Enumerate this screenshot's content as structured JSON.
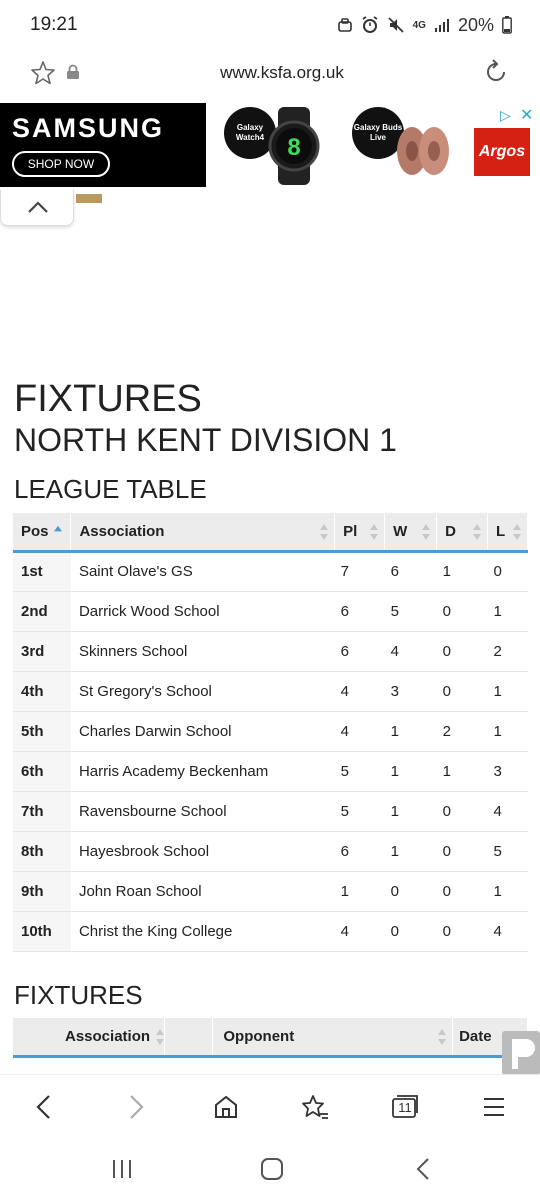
{
  "status": {
    "time": "19:21",
    "network": "4G",
    "battery": "20%"
  },
  "browser": {
    "url": "www.ksfa.org.uk",
    "tab_count": "11"
  },
  "ad": {
    "brand": "SAMSUNG",
    "shop_label": "SHOP NOW",
    "product1": "Galaxy Watch4",
    "product2": "Galaxy Buds Live",
    "retailer": "Argos"
  },
  "page": {
    "title": "FIXTURES",
    "division": "NORTH KENT DIVISION 1",
    "league_table_heading": "LEAGUE TABLE",
    "fixtures_heading": "FIXTURES"
  },
  "league_table": {
    "headers": {
      "pos": "Pos",
      "association": "Association",
      "pl": "Pl",
      "w": "W",
      "d": "D",
      "l": "L"
    },
    "rows": [
      {
        "pos": "1st",
        "association": "Saint Olave's GS",
        "pl": "7",
        "w": "6",
        "d": "1",
        "l": "0"
      },
      {
        "pos": "2nd",
        "association": "Darrick Wood School",
        "pl": "6",
        "w": "5",
        "d": "0",
        "l": "1"
      },
      {
        "pos": "3rd",
        "association": "Skinners School",
        "pl": "6",
        "w": "4",
        "d": "0",
        "l": "2"
      },
      {
        "pos": "4th",
        "association": "St Gregory's School",
        "pl": "4",
        "w": "3",
        "d": "0",
        "l": "1"
      },
      {
        "pos": "5th",
        "association": "Charles Darwin School",
        "pl": "4",
        "w": "1",
        "d": "2",
        "l": "1"
      },
      {
        "pos": "6th",
        "association": "Harris Academy Beckenham",
        "pl": "5",
        "w": "1",
        "d": "1",
        "l": "3"
      },
      {
        "pos": "7th",
        "association": "Ravensbourne School",
        "pl": "5",
        "w": "1",
        "d": "0",
        "l": "4"
      },
      {
        "pos": "8th",
        "association": "Hayesbrook School",
        "pl": "6",
        "w": "1",
        "d": "0",
        "l": "5"
      },
      {
        "pos": "9th",
        "association": "John Roan School",
        "pl": "1",
        "w": "0",
        "d": "0",
        "l": "1"
      },
      {
        "pos": "10th",
        "association": "Christ the King College",
        "pl": "4",
        "w": "0",
        "d": "0",
        "l": "4"
      }
    ]
  },
  "fixtures_table": {
    "headers": {
      "association": "Association",
      "blank": "",
      "opponent": "Opponent",
      "date": "Date"
    }
  },
  "colors": {
    "accent": "#4a9bd3",
    "header_bg": "#ececec"
  }
}
